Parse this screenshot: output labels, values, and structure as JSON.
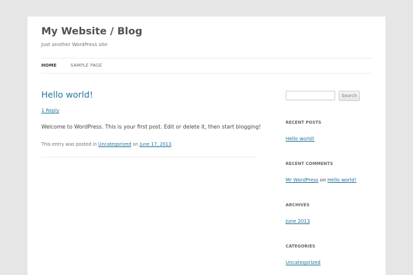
{
  "header": {
    "site_title": "My Website / Blog",
    "tagline": "Just another WordPress site"
  },
  "nav": {
    "items": [
      {
        "label": "HOME",
        "current": true
      },
      {
        "label": "SAMPLE PAGE",
        "current": false
      }
    ]
  },
  "post": {
    "title": "Hello world!",
    "reply": "1 Reply",
    "body": "Welcome to WordPress. This is your first post. Edit or delete it, then start blogging!",
    "meta_prefix": "This entry was posted in ",
    "category": "Uncategorized",
    "meta_on": " on ",
    "date": "June 17, 2013",
    "meta_suffix": "."
  },
  "sidebar": {
    "search": {
      "placeholder": "",
      "button_label": "Search"
    },
    "recent_posts": {
      "title": "RECENT POSTS",
      "items": [
        "Hello world!"
      ]
    },
    "recent_comments": {
      "title": "RECENT COMMENTS",
      "author": "Mr WordPress",
      "on": " on ",
      "post": "Hello world!"
    },
    "archives": {
      "title": "ARCHIVES",
      "items": [
        "June 2013"
      ]
    },
    "categories": {
      "title": "CATEGORIES",
      "items": [
        "Uncategorized"
      ]
    }
  },
  "colors": {
    "background": "#e6e6e6",
    "page": "#ffffff",
    "link": "#21759b",
    "text": "#444444"
  }
}
